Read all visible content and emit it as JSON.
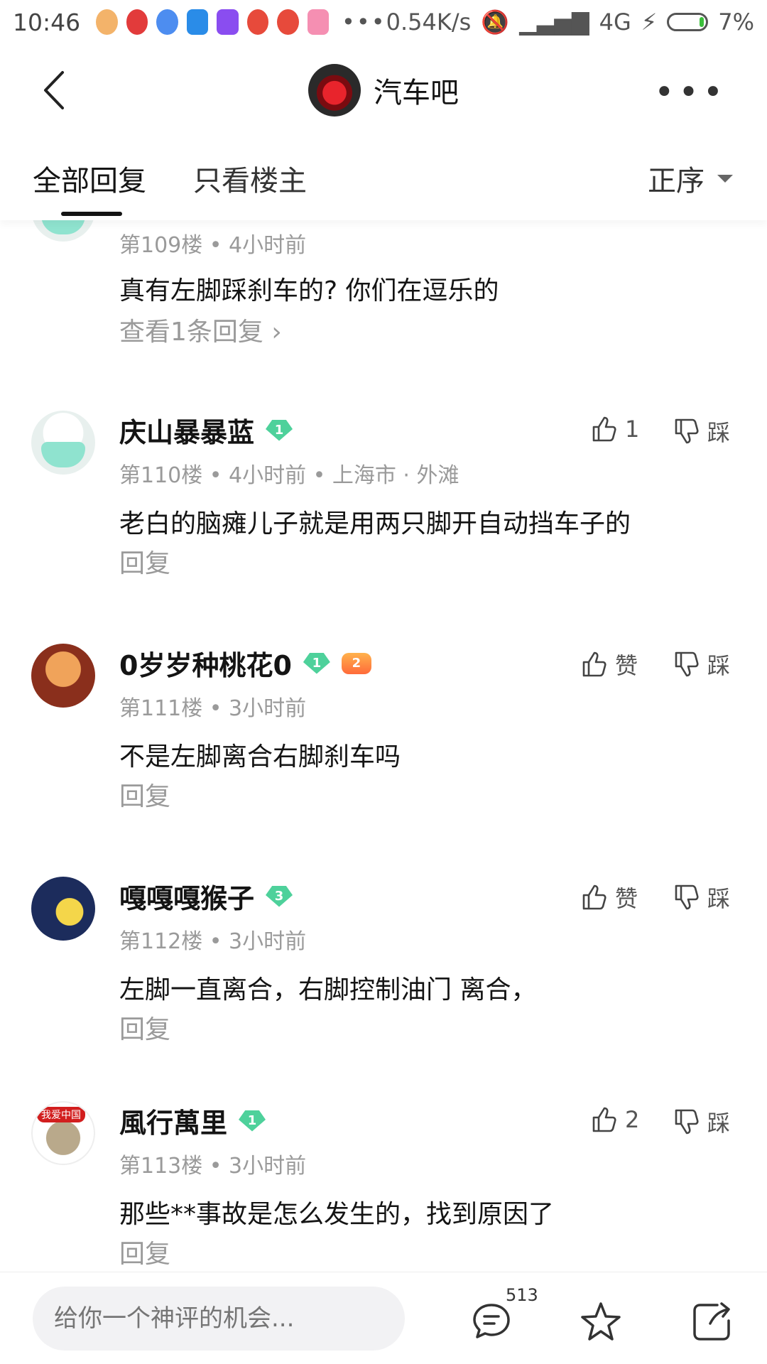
{
  "status": {
    "time": "10:46",
    "more": "•••",
    "network_speed": "0.54K/s",
    "network_type": "4G",
    "battery": "7%"
  },
  "header": {
    "forum_name": "汽车吧",
    "more": "•••"
  },
  "tabs": {
    "all_replies": "全部回复",
    "only_op": "只看楼主",
    "sort": "正序"
  },
  "posts": [
    {
      "floor_time": "第109楼 • 4小时前",
      "content": "真有左脚踩刹车的? 你们在逗乐的",
      "view_replies": "查看1条回复 ›"
    },
    {
      "username": "庆山暴暴蓝",
      "level": "1",
      "like_label": "1",
      "dislike_label": "踩",
      "floor_time": "第110楼 • 4小时前 • 上海市 · 外滩",
      "content": "老白的脑瘫儿子就是用两只脚开自动挡车子的",
      "reply": "回复"
    },
    {
      "username": "0岁岁种桃花0",
      "level": "1",
      "game_level": "2",
      "like_label": "赞",
      "dislike_label": "踩",
      "floor_time": "第111楼 • 3小时前",
      "content": "不是左脚离合右脚刹车吗",
      "reply": "回复"
    },
    {
      "username": "嘎嘎嘎猴子",
      "level": "3",
      "like_label": "赞",
      "dislike_label": "踩",
      "floor_time": "第112楼 • 3小时前",
      "content": "左脚一直离合，右脚控制油门 离合，",
      "reply": "回复"
    },
    {
      "username": "風行萬里",
      "level": "1",
      "avatar_tag": "我爱中国",
      "like_label": "2",
      "dislike_label": "踩",
      "floor_time": "第113楼 • 3小时前",
      "content": "那些**事故是怎么发生的，找到原因了",
      "reply": "回复"
    }
  ],
  "bottom": {
    "input_placeholder": "给你一个神评的机会...",
    "comment_count": "513"
  }
}
